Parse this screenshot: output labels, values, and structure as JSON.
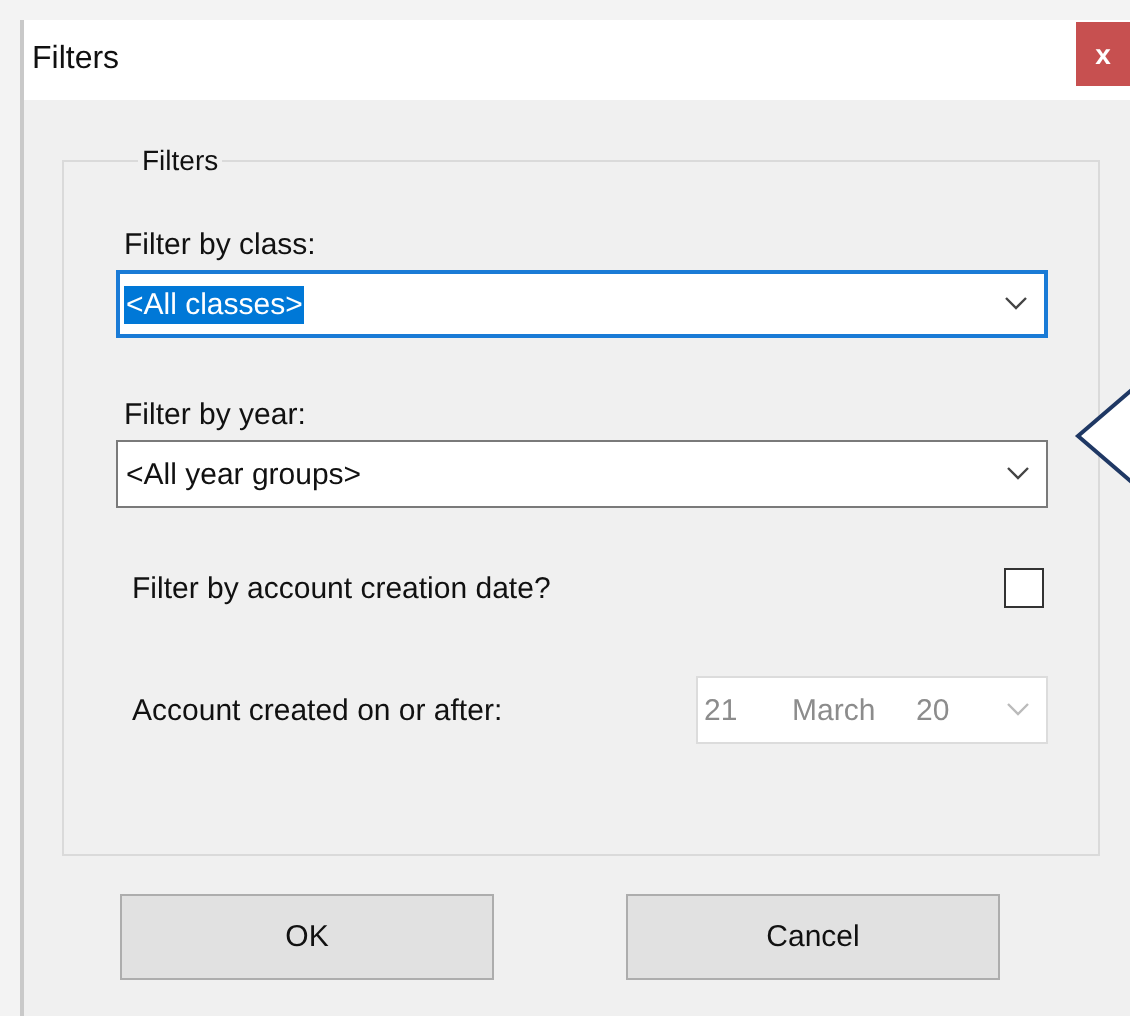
{
  "window": {
    "title": "Filters",
    "close_label": "x"
  },
  "group": {
    "title": "Filters"
  },
  "fields": [
    {
      "kind": "combo",
      "label": "Filter by class:",
      "value": "<All classes>",
      "focused": true,
      "text_selected": true
    },
    {
      "kind": "combo",
      "label": "Filter by year:",
      "value": "<All year groups>",
      "focused": false,
      "text_selected": false
    },
    {
      "kind": "checkbox",
      "label": "Filter by account creation date?",
      "checked": false
    },
    {
      "kind": "date",
      "label": "Account created on or after:",
      "day": "21",
      "month": "March",
      "year": "20",
      "disabled": true
    }
  ],
  "buttons": [
    "OK",
    "Cancel"
  ]
}
